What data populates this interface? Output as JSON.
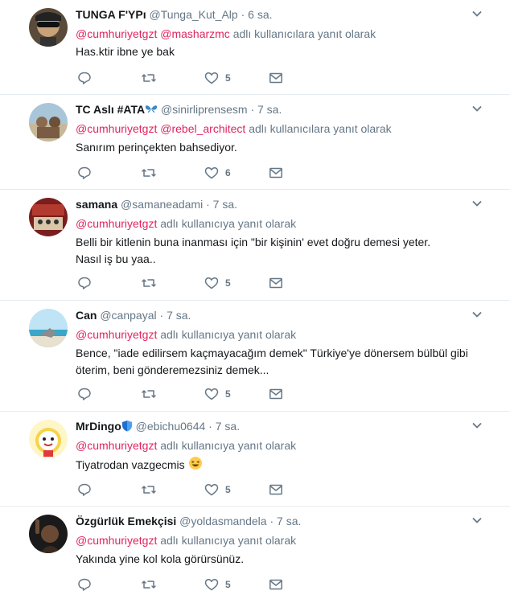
{
  "reply_word_single": "adlı kullanıcıya yanıt olarak",
  "reply_word_multi": "adlı kullanıcılara yanıt olarak",
  "tweets": [
    {
      "name": "TUNGA F'YPı",
      "handle": "@Tunga_Kut_Alp",
      "time": "6 sa.",
      "mentions": [
        "@cumhuriyetgzt",
        "@masharzmc"
      ],
      "reply_text": "adlı kullanıcılara yanıt olarak",
      "text": "Has.ktir ibne ye bak",
      "likes": "5"
    },
    {
      "name": "TC Aslı #ATA",
      "handle": "@sinirliprensesm",
      "time": "7 sa.",
      "mentions": [
        "@cumhuriyetgzt",
        "@rebel_architect"
      ],
      "reply_text": "adlı kullanıcılara yanıt olarak",
      "text": "Sanırım perinçekten bahsediyor.",
      "likes": "6"
    },
    {
      "name": "samana",
      "handle": "@samaneadami",
      "time": "7 sa.",
      "mentions": [
        "@cumhuriyetgzt"
      ],
      "reply_text": "adlı kullanıcıya yanıt olarak",
      "text_lines": [
        "Belli bir kitlenin buna inanması için \"bir kişinin' evet doğru demesi yeter.",
        "Nasıl iş bu yaa.."
      ],
      "likes": "5"
    },
    {
      "name": "Can",
      "handle": "@canpayal",
      "time": "7 sa.",
      "mentions": [
        "@cumhuriyetgzt"
      ],
      "reply_text": "adlı kullanıcıya yanıt olarak",
      "text_lines": [
        "Bence, \"iade edilirsem kaçmayacağım demek\" Türkiye'ye dönersem bülbül gibi",
        "öterim, beni gönderemezsiniz demek..."
      ],
      "likes": "5"
    },
    {
      "name": "MrDingo",
      "handle": "@ebichu0644",
      "time": "7 sa.",
      "mentions": [
        "@cumhuriyetgzt"
      ],
      "reply_text": "adlı kullanıcıya yanıt olarak",
      "text": "Tiyatrodan vazgecmis",
      "emoji": "😆",
      "likes": "5"
    },
    {
      "name": "Özgürlük Emekçisi",
      "handle": "@yoldasmandela",
      "time": "7 sa.",
      "mentions": [
        "@cumhuriyetgzt"
      ],
      "reply_text": "adlı kullanıcıya yanıt olarak",
      "text": "Yakında yine kol kola görürsünüz.",
      "likes": "5"
    }
  ],
  "colors": {
    "mention": "#e0245e",
    "secondary": "#657786",
    "divider": "#e6ecf0"
  },
  "icons": [
    "reply-icon",
    "retweet-icon",
    "like-icon",
    "dm-icon",
    "chevron-down-icon",
    "butterfly-emoji",
    "shield-badge-icon"
  ]
}
